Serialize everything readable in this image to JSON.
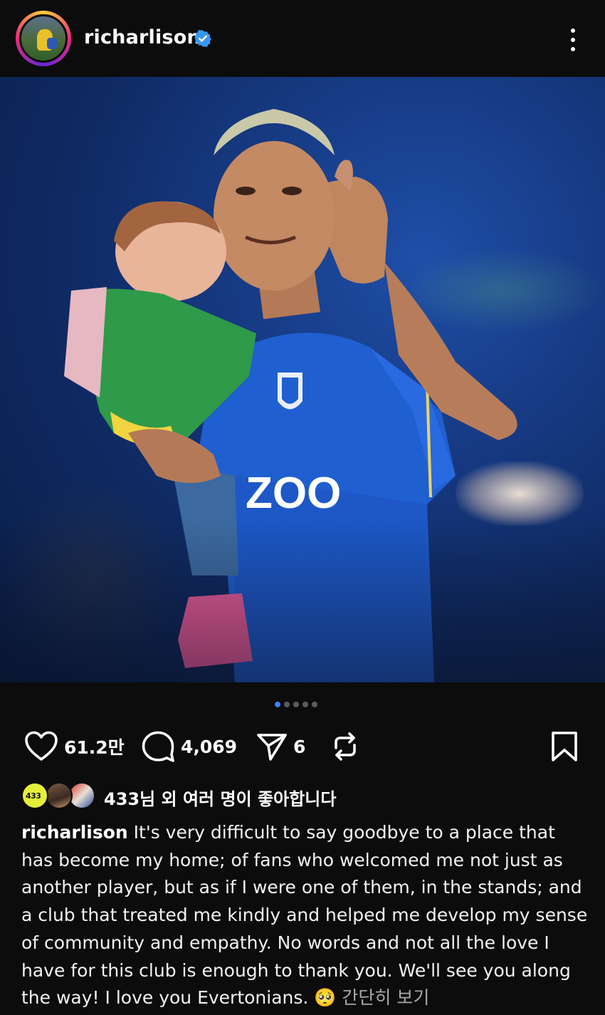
{
  "header": {
    "username": "richarlison",
    "verified": true,
    "avatar_icon": "profile-avatar",
    "more_icon": "more-vertical-icon"
  },
  "post": {
    "image_description_icon": "post-photo",
    "carousel": {
      "total": 5,
      "active_index": 0
    }
  },
  "actions": {
    "like_count": "61.2만",
    "comment_count": "4,069",
    "share_count": "6",
    "icons": {
      "like": "heart-icon",
      "comment": "comment-bubble-icon",
      "share": "send-icon",
      "repost": "repost-icon",
      "save": "bookmark-icon"
    }
  },
  "liked_by": {
    "avatar1_text": "433",
    "text": "433님 외 여러 명이 좋아합니다"
  },
  "caption": {
    "username": "richarlison",
    "text": " It's very difficult to say goodbye to a place that has become my home; of fans who welcomed me not just as another player, but as if I were one of them, in the stands; and a club that treated me kindly and helped me develop my sense of community and empathy.  No words and not all the love I have for this club is enough to thank you. We'll see you along the way!  I love you Evertonians. ",
    "emoji": "🥺",
    "more_label": " 간단히 보기"
  },
  "colors": {
    "background": "#0c0c0d",
    "accent": "#3b82f6",
    "verified_badge": "#3897f0"
  }
}
